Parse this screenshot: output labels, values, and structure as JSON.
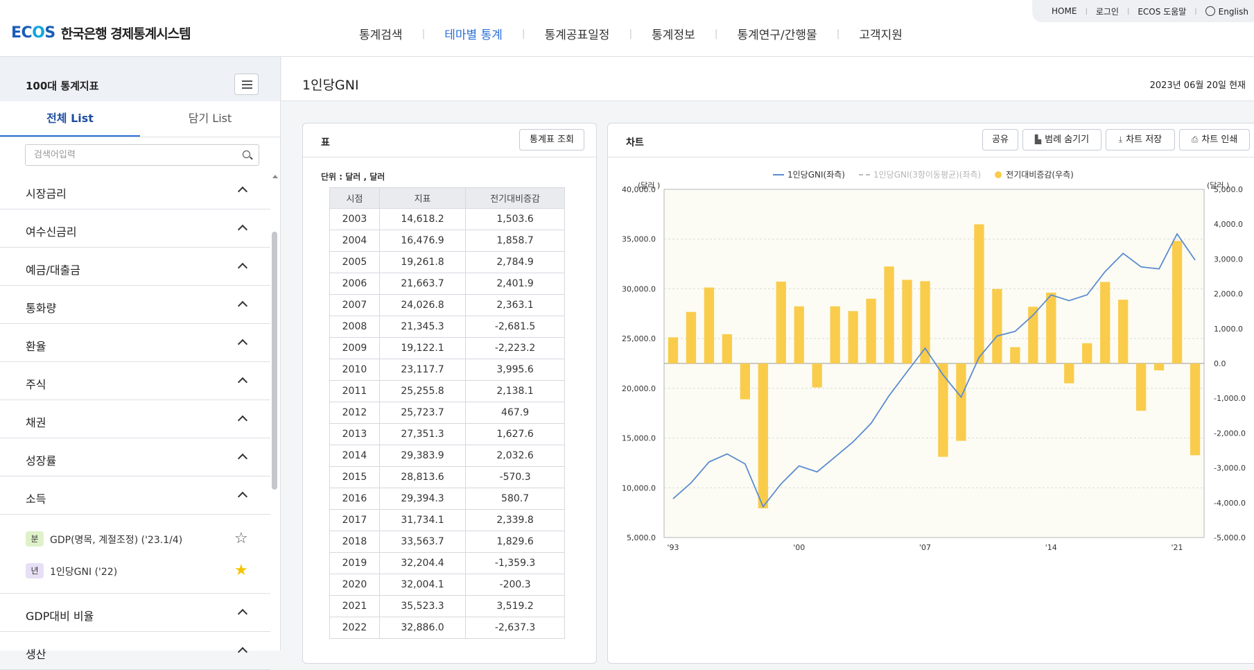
{
  "util_nav": [
    "HOME",
    "로그인",
    "ECOS 도움말"
  ],
  "util_lang": "English",
  "logo": {
    "brand_a": "EC",
    "brand_b": "O",
    "brand_c": "S",
    "name": "한국은행 경제통계시스템"
  },
  "gnb": [
    "통계검색",
    "테마별 통계",
    "통계공표일정",
    "통계정보",
    "통계연구/간행물",
    "고객지원"
  ],
  "sidebar": {
    "title": "100대 통계지표",
    "tabs": [
      "전체 List",
      "담기 List"
    ],
    "search_placeholder": "검색어입력",
    "categories": [
      "시장금리",
      "여수신금리",
      "예금/대출금",
      "통화량",
      "환율",
      "주식",
      "채권",
      "성장률",
      "소득"
    ],
    "sub_items": [
      {
        "badge": "분",
        "label": "GDP(명목, 계절조정) ('23.1/4)"
      },
      {
        "badge": "년",
        "label": "1인당GNI ('22)"
      }
    ],
    "after_categories": [
      "GDP대비 비율",
      "생산"
    ]
  },
  "page": {
    "title": "1인당GNI",
    "date": "2023년 06월 20일 현재"
  },
  "table_panel": {
    "title": "표",
    "button": "통계표 조회",
    "unit": "단위 : 달러 , 달러",
    "headers": [
      "시점",
      "지표",
      "전기대비증감"
    ],
    "rows": [
      [
        "2003",
        "14,618.2",
        "1,503.6"
      ],
      [
        "2004",
        "16,476.9",
        "1,858.7"
      ],
      [
        "2005",
        "19,261.8",
        "2,784.9"
      ],
      [
        "2006",
        "21,663.7",
        "2,401.9"
      ],
      [
        "2007",
        "24,026.8",
        "2,363.1"
      ],
      [
        "2008",
        "21,345.3",
        "-2,681.5"
      ],
      [
        "2009",
        "19,122.1",
        "-2,223.2"
      ],
      [
        "2010",
        "23,117.7",
        "3,995.6"
      ],
      [
        "2011",
        "25,255.8",
        "2,138.1"
      ],
      [
        "2012",
        "25,723.7",
        "467.9"
      ],
      [
        "2013",
        "27,351.3",
        "1,627.6"
      ],
      [
        "2014",
        "29,383.9",
        "2,032.6"
      ],
      [
        "2015",
        "28,813.6",
        "-570.3"
      ],
      [
        "2016",
        "29,394.3",
        "580.7"
      ],
      [
        "2017",
        "31,734.1",
        "2,339.8"
      ],
      [
        "2018",
        "33,563.7",
        "1,829.6"
      ],
      [
        "2019",
        "32,204.4",
        "-1,359.3"
      ],
      [
        "2020",
        "32,004.1",
        "-200.3"
      ],
      [
        "2021",
        "35,523.3",
        "3,519.2"
      ],
      [
        "2022",
        "32,886.0",
        "-2,637.3"
      ]
    ]
  },
  "chart_panel": {
    "title": "차트",
    "buttons": [
      "공유",
      "범례 숨기기",
      "차트 저장",
      "차트 인쇄"
    ]
  },
  "chart_data": {
    "type": "bar",
    "legend": [
      "1인당GNI(좌측)",
      "1인당GNI(3항이동평균)(좌측)",
      "전기대비증감(우측)"
    ],
    "left_unit": "(달러 )",
    "right_unit": "(달러 )",
    "left_ticks": [
      "40,000.0",
      "35,000.0",
      "30,000.0",
      "25,000.0",
      "20,000.0",
      "15,000.0",
      "10,000.0",
      "5,000.0"
    ],
    "right_ticks": [
      "5,000.0",
      "4,000.0",
      "3,000.0",
      "2,000.0",
      "1,000.0",
      "0.0",
      "-1,000.0",
      "-2,000.0",
      "-3,000.0",
      "-4,000.0",
      "-5,000.0"
    ],
    "x_ticks": [
      "'93",
      "'00",
      "'07",
      "'14",
      "'21"
    ],
    "ylim_left": [
      5000,
      40000
    ],
    "ylim_right": [
      -5000,
      5000
    ],
    "x_start": 1993,
    "x_end": 2022,
    "years": [
      1993,
      1994,
      1995,
      1996,
      1997,
      1998,
      1999,
      2000,
      2001,
      2002,
      2003,
      2004,
      2005,
      2006,
      2007,
      2008,
      2009,
      2010,
      2011,
      2012,
      2013,
      2014,
      2015,
      2016,
      2017,
      2018,
      2019,
      2020,
      2021,
      2022
    ],
    "series": [
      {
        "name": "1인당GNI(좌측)",
        "color": "#5b8bd0",
        "values": [
          8900,
          10500,
          12600,
          13400,
          12400,
          8100,
          10400,
          12200,
          11600,
          13100,
          14618.2,
          16476.9,
          19261.8,
          21663.7,
          24026.8,
          21345.3,
          19122.1,
          23117.7,
          25255.8,
          25723.7,
          27351.3,
          29383.9,
          28813.6,
          29394.3,
          31734.1,
          33563.7,
          32204.4,
          32004.1,
          35523.3,
          32886.0
        ]
      },
      {
        "name": "전기대비증감(우측)",
        "color": "#f9cc4b",
        "values": [
          750,
          1480,
          2180,
          840,
          -1030,
          -4160,
          2350,
          1640,
          -690,
          1640,
          1503.6,
          1858.7,
          2784.9,
          2401.9,
          2363.1,
          -2681.5,
          -2223.2,
          3995.6,
          2138.1,
          467.9,
          1627.6,
          2032.6,
          -570.3,
          580.7,
          2339.8,
          1829.6,
          -1359.3,
          -200.3,
          3519.2,
          -2637.3
        ]
      }
    ]
  }
}
